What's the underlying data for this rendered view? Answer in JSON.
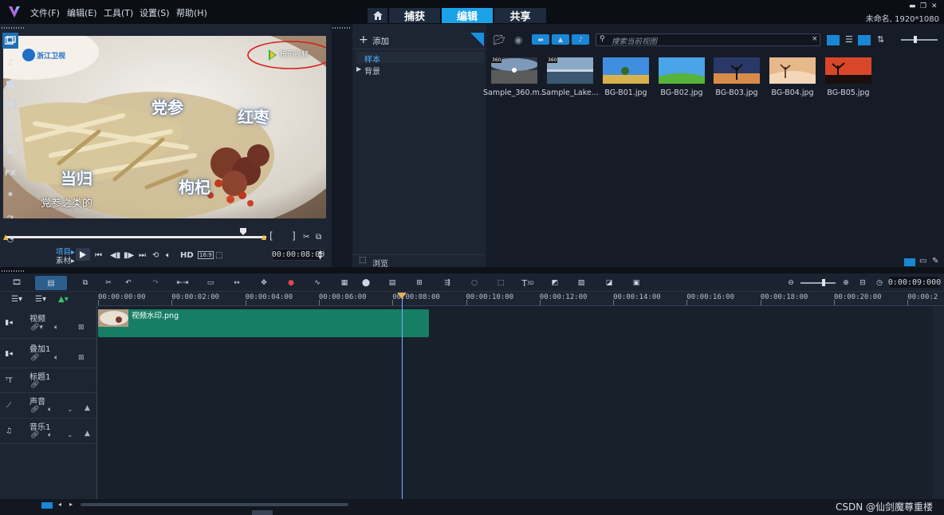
{
  "menu": {
    "items": [
      "文件(F)",
      "编辑(E)",
      "工具(T)",
      "设置(S)",
      "帮助(H)"
    ]
  },
  "tabs": {
    "capture": "捕获",
    "edit": "编辑",
    "share": "共享"
  },
  "project_info": "未命名, 1920*1080",
  "preview": {
    "logo_text": "浙江卫视",
    "watermark_text": "腾讯视频",
    "labels": [
      "党参",
      "红枣",
      "当归",
      "枸杞"
    ],
    "subtitle": "党参之类的",
    "mode_project": "项目▸",
    "mode_clip": "素材▸",
    "hd_label": "HD",
    "aspect_label": "16:9",
    "bracket_in": "[",
    "bracket_out": "]",
    "timecode": "00:00:08:00"
  },
  "library": {
    "add_label": "添加",
    "tree_items": [
      "样本",
      "背景"
    ],
    "search_placeholder": "搜索当前视图",
    "browse_label": "浏览",
    "thumbnails": [
      {
        "label": "Sample_360.m...",
        "badge": "360"
      },
      {
        "label": "Sample_Lake...",
        "badge": "360"
      },
      {
        "label": "BG-B01.jpg"
      },
      {
        "label": "BG-B02.jpg"
      },
      {
        "label": "BG-B03.jpg"
      },
      {
        "label": "BG-B04.jpg"
      },
      {
        "label": "BG-B05.jpg"
      }
    ]
  },
  "side_toolbar": {
    "fx_label": "FX"
  },
  "timeline": {
    "duration": "0:00:09:000",
    "ruler": [
      "00:00:00:00",
      "00:00:02:00",
      "00:00:04:00",
      "00:00:06:00",
      "00:00:08:00",
      "00:00:10:00",
      "00:00:12:00",
      "00:00:14:00",
      "00:00:16:00",
      "00:00:18:00",
      "00:00:20:00",
      "00:00:2"
    ],
    "tracks": [
      "视频",
      "叠加1",
      "标题1",
      "声音",
      "音乐1"
    ],
    "clip_name": "视频水印.png"
  },
  "caption": "CSDN @仙剑魔尊重楼"
}
